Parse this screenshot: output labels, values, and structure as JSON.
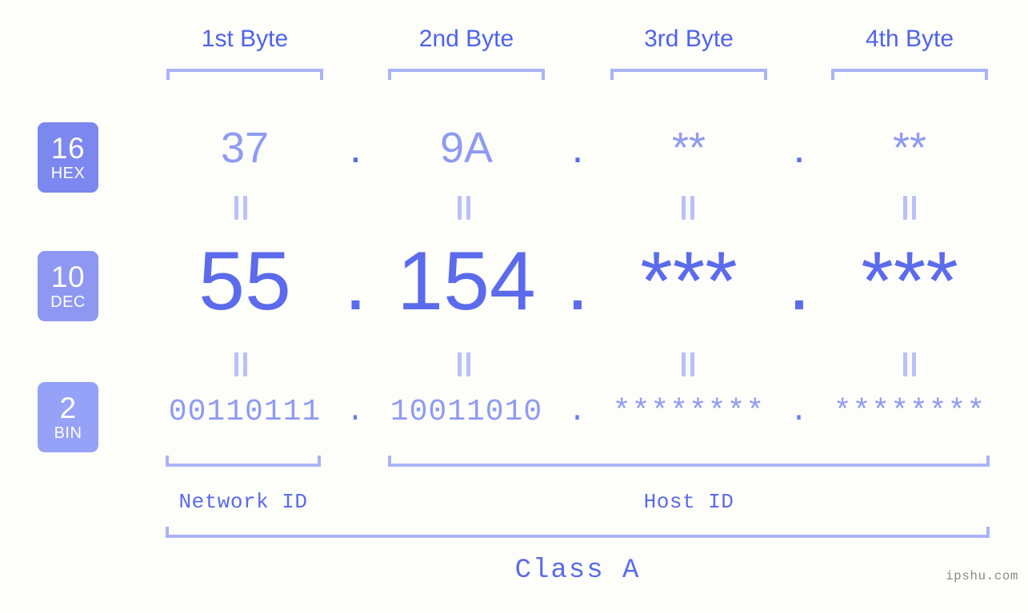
{
  "background": "#fdfdfa",
  "colors": {
    "heading": "#4e63ea",
    "bracket": "#aab3f6",
    "hex_value": "#8e9bf2",
    "dec_value": "#5b6bec",
    "bin_value": "#8e9bf2",
    "badge_hex": "#7c87ef",
    "badge_dec": "#8e98f3",
    "badge_bin": "#96a2f7",
    "equals": "#b9c1f8",
    "watermark": "#8a8a8a"
  },
  "byte_headers": [
    {
      "label": "1st Byte"
    },
    {
      "label": "2nd Byte"
    },
    {
      "label": "3rd Byte"
    },
    {
      "label": "4th Byte"
    }
  ],
  "bases": [
    {
      "number": "16",
      "name": "HEX"
    },
    {
      "number": "10",
      "name": "DEC"
    },
    {
      "number": "2",
      "name": "BIN"
    }
  ],
  "rows": {
    "hex": {
      "values": [
        "37",
        "9A",
        "**",
        "**"
      ],
      "separator": "."
    },
    "dec": {
      "values": [
        "55",
        "154",
        "***",
        "***"
      ],
      "separator": "."
    },
    "bin": {
      "values": [
        "00110111",
        "10011010",
        "********",
        "********"
      ],
      "separator": "."
    }
  },
  "equals_symbol": "=",
  "sections": {
    "network_id": "Network ID",
    "host_id": "Host ID",
    "class": "Class A"
  },
  "watermark": "ipshu.com"
}
